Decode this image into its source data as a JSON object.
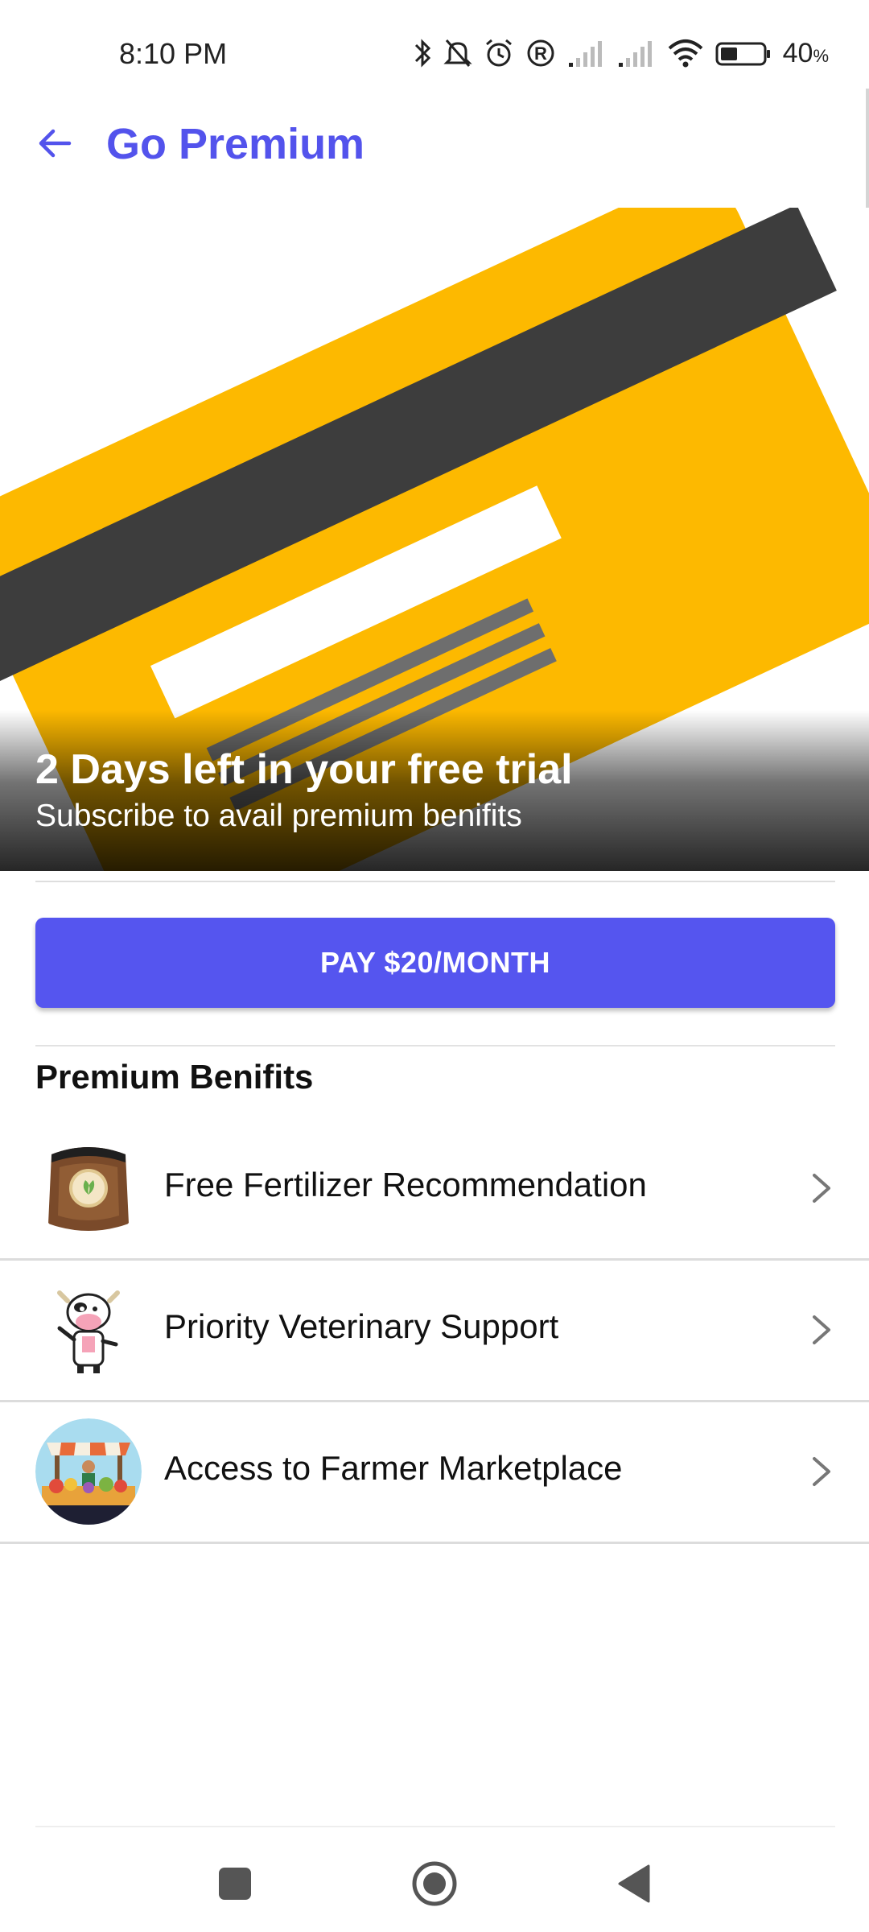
{
  "status_bar": {
    "time": "8:10 PM",
    "battery_percent": "40",
    "battery_unit": "%",
    "battery_level": 0.4,
    "icons": [
      "bluetooth-icon",
      "bell-off-icon",
      "alarm-icon",
      "registered-icon",
      "signal-icon",
      "signal-icon",
      "wifi-icon",
      "battery-icon"
    ]
  },
  "app_bar": {
    "title": "Go Premium",
    "back_icon": "arrow-left-icon"
  },
  "hero": {
    "title": "2 Days left in your free trial",
    "subtitle": "Subscribe to avail premium benifits",
    "image": "credit-card-illustration"
  },
  "pay_button": {
    "label": "PAY $20/MONTH"
  },
  "benefits": {
    "title": "Premium Benifits",
    "items": [
      {
        "label": "Free Fertilizer Recommendation",
        "icon": "fertilizer-sack-icon"
      },
      {
        "label": "Priority Veterinary Support",
        "icon": "cow-doctor-icon"
      },
      {
        "label": "Access to Farmer Marketplace",
        "icon": "market-stall-icon"
      }
    ]
  },
  "nav_bar": {
    "buttons": [
      "recents-icon",
      "home-icon",
      "back-icon"
    ]
  },
  "colors": {
    "accent": "#5353ec",
    "card_yellow": "#fdb900",
    "card_stripe": "#3d3d3d"
  }
}
